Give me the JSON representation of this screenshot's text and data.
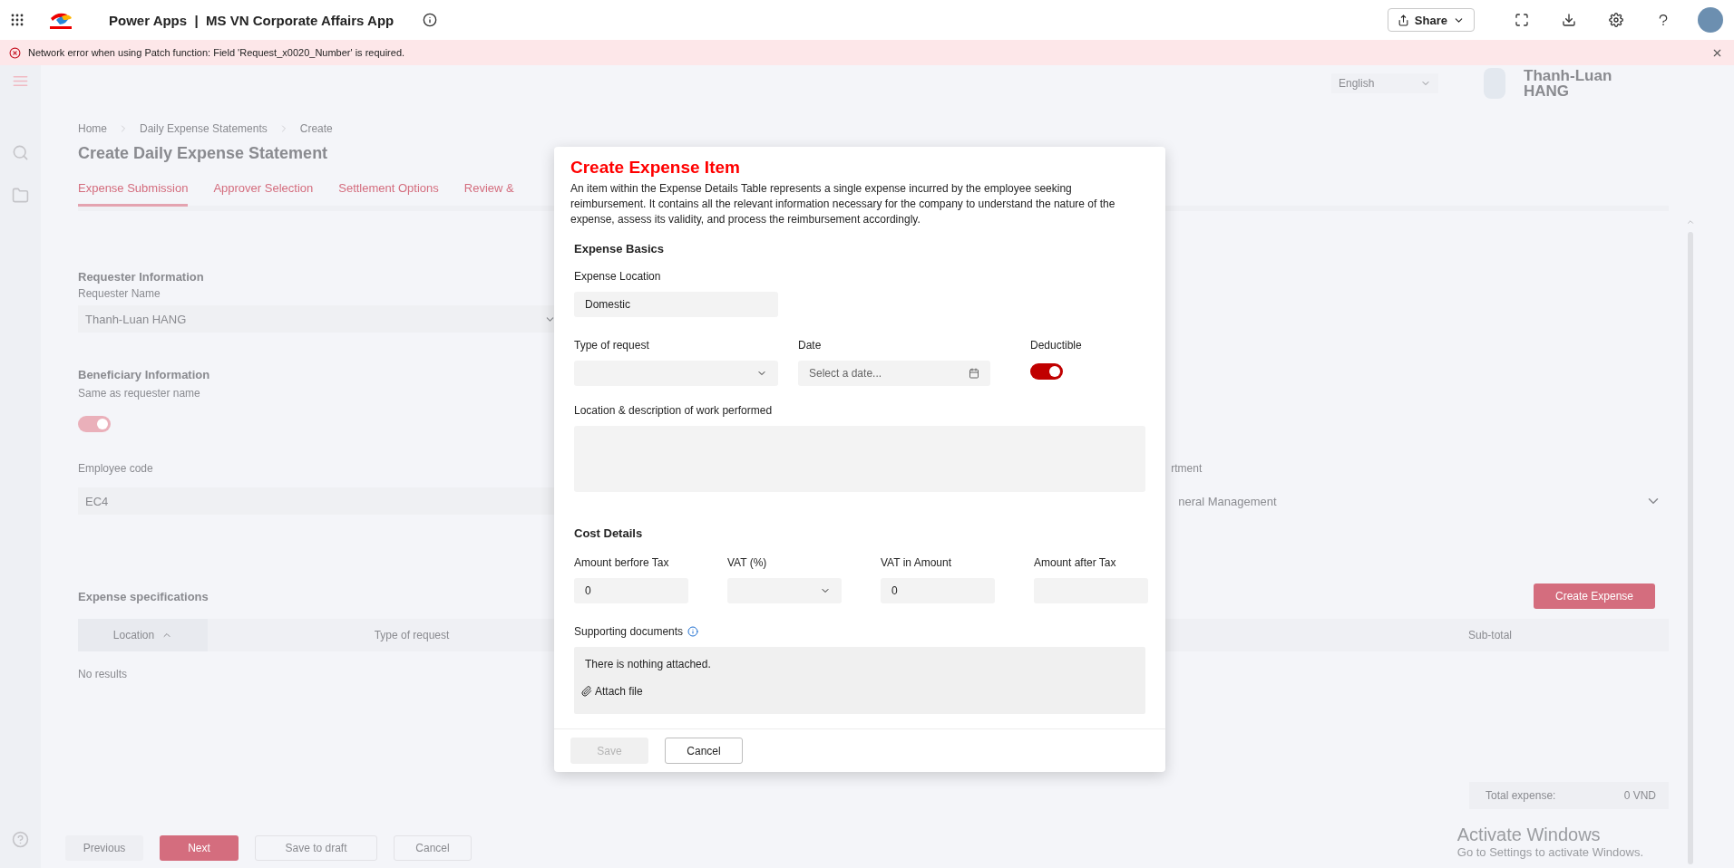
{
  "app_bar": {
    "title": "Power Apps  |  MS VN Corporate Affairs App",
    "share_label": "Share"
  },
  "error_banner": {
    "message": "Network error when using Patch function: Field 'Request_x0020_Number' is required."
  },
  "header": {
    "language": "English",
    "user_name": "Thanh-Luan HANG"
  },
  "breadcrumb": [
    "Home",
    "Daily Expense Statements",
    "Create"
  ],
  "page_title": "Create Daily Expense Statement",
  "tabs": [
    {
      "label": "Expense Submission",
      "selected": true
    },
    {
      "label": "Approver Selection",
      "selected": false
    },
    {
      "label": "Settlement Options",
      "selected": false
    },
    {
      "label": "Review &",
      "selected": false
    }
  ],
  "requester": {
    "heading": "Requester Information",
    "name_label": "Requester Name",
    "name_value": "Thanh-Luan HANG"
  },
  "beneficiary": {
    "heading": "Beneficiary Information",
    "same_label": "Same as requester name",
    "same_as_requester": true,
    "employee_code_label": "Employee code",
    "employee_code_value": "EC4",
    "department_label": "rtment",
    "department_value": "neral Management"
  },
  "expense_specs": {
    "heading": "Expense specifications",
    "create_button": "Create Expense",
    "columns": [
      {
        "label": "Location",
        "sorted": true
      },
      {
        "label": "Type of request",
        "sorted": false
      },
      {
        "label": "Sub-total",
        "sorted": false
      }
    ],
    "empty_text": "No results",
    "total_label": "Total expense:",
    "total_value": "0 VND"
  },
  "footer_buttons": [
    {
      "label": "Previous",
      "kind": "ghost"
    },
    {
      "label": "Next",
      "kind": "primary"
    },
    {
      "label": "Save to draft",
      "kind": "outline"
    },
    {
      "label": "Cancel",
      "kind": "outline"
    }
  ],
  "dialog": {
    "title": "Create Expense Item",
    "description": "An item within the Expense Details Table represents a single expense incurred by the employee seeking reimbursement. It contains all the relevant information necessary for the company to understand the nature of the expense, assess its validity, and process the reimbursement accordingly.",
    "basics_heading": "Expense Basics",
    "location_label": "Expense Location",
    "location_value": "Domestic",
    "type_label": "Type of request",
    "date_label": "Date",
    "date_placeholder": "Select a date...",
    "deductible_label": "Deductible",
    "deductible_on": true,
    "work_label": "Location & description of work performed",
    "cost_heading": "Cost Details",
    "cost_fields": [
      {
        "label": "Amount berfore Tax",
        "value": "0",
        "kind": "input"
      },
      {
        "label": "VAT (%)",
        "kind": "dropdown"
      },
      {
        "label": "VAT in Amount",
        "value": "0",
        "kind": "input"
      },
      {
        "label": "Amount after Tax",
        "kind": "input"
      }
    ],
    "docs_label": "Supporting documents",
    "docs_empty": "There is nothing attached.",
    "attach_label": "Attach file",
    "buttons": [
      {
        "label": "Save",
        "disabled": true
      },
      {
        "label": "Cancel",
        "disabled": false
      }
    ]
  },
  "os_notice": {
    "title": "Activate Windows",
    "text": "Go to Settings to activate Windows."
  }
}
